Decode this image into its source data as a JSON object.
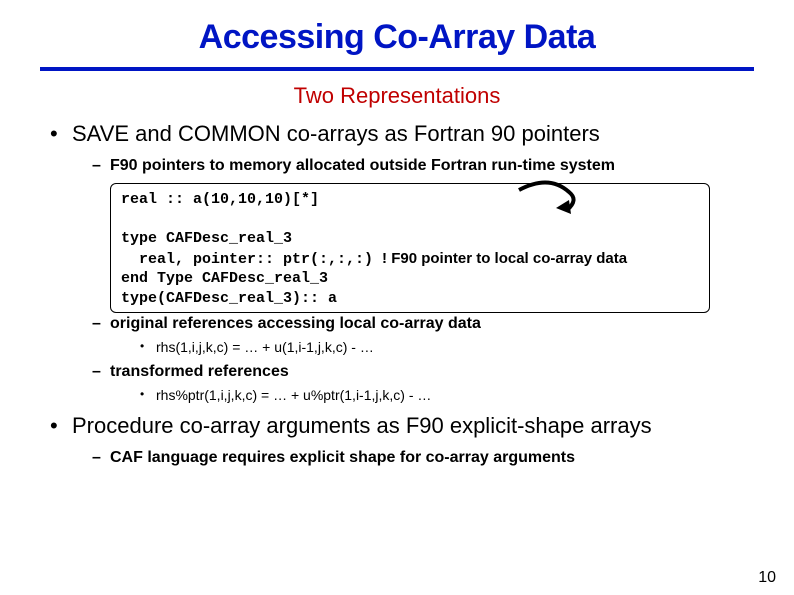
{
  "title": "Accessing Co-Array Data",
  "subtitle": "Two Representations",
  "bullet1": "SAVE and COMMON co-arrays as Fortran 90 pointers",
  "dash1": "F90 pointers to memory allocated outside Fortran run-time system",
  "code": {
    "l1": "real :: a(10,10,10)[*]",
    "l2": "type CAFDesc_real_3",
    "l3_pre": "  real, pointer:: ptr(:,:,:) ",
    "l3_cmt": "! F90 pointer to local co-array data",
    "l4": "end Type CAFDesc_real_3",
    "l5": "type(CAFDesc_real_3):: a"
  },
  "dash2": "original references accessing local co-array data",
  "dot1": "rhs(1,i,j,k,c) = … + u(1,i-1,j,k,c) - …",
  "dash3": "transformed references",
  "dot2": "rhs%ptr(1,i,j,k,c) = … + u%ptr(1,i-1,j,k,c) - …",
  "bullet2": "Procedure co-array arguments as F90 explicit-shape arrays",
  "dash4": "CAF language requires explicit shape for co-array arguments",
  "page": "10"
}
